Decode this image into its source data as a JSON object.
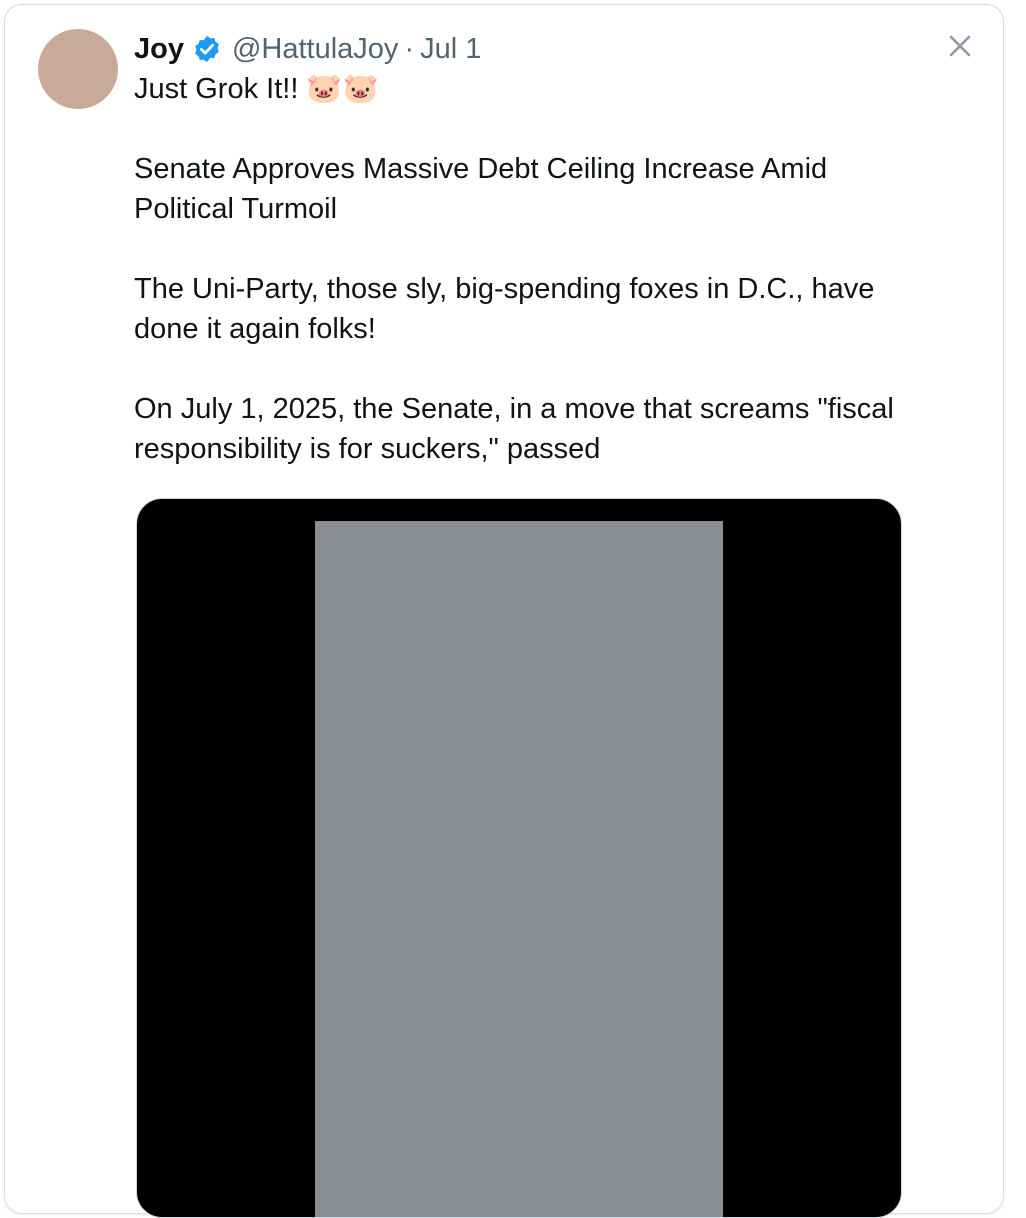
{
  "tweet": {
    "author_name": "Joy",
    "handle": "@HattulaJoy",
    "separator": "·",
    "date": "Jul 1",
    "verified_icon": "verified-badge-icon",
    "lines": [
      "Just Grok It!! 🐷🐷",
      "Senate Approves Massive Debt Ceiling Increase Amid Political Turmoil",
      "The Uni-Party, those sly, big-spending foxes in D.C., have done it again folks!",
      "On July 1, 2025, the Senate, in a move that screams \"fiscal responsibility is for suckers,\" passed"
    ]
  },
  "controls": {
    "close_icon": "close-icon"
  },
  "colors": {
    "verified": "#1d9bf0",
    "secondary_text": "#536471",
    "border": "#d7dde2"
  }
}
